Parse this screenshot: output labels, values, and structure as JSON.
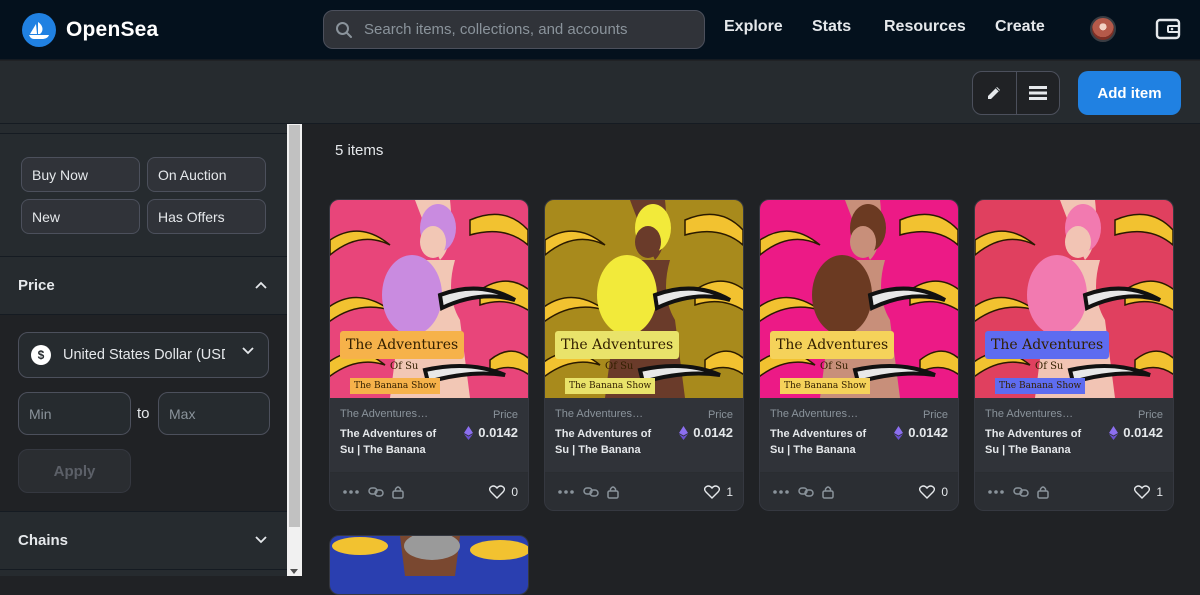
{
  "nav": {
    "brand": "OpenSea",
    "search_placeholder": "Search items, collections, and accounts",
    "links": [
      "Explore",
      "Stats",
      "Resources",
      "Create"
    ]
  },
  "toolbar": {
    "add_item": "Add item"
  },
  "sidebar": {
    "status_filters": [
      "Buy Now",
      "On Auction",
      "New",
      "Has Offers"
    ],
    "price_header": "Price",
    "currency_symbol": "$",
    "currency": "United States Dollar (USD)",
    "min_placeholder": "Min",
    "max_placeholder": "Max",
    "to_label": "to",
    "apply": "Apply",
    "chains_header": "Chains"
  },
  "main": {
    "count": "5 items",
    "cards": [
      {
        "collection": "The Adventures of Su",
        "name": "The Adventures of Su | The Banana Show",
        "price_label": "Price",
        "price": "0.0142",
        "likes": "0",
        "bg": "#e8457a",
        "hair": "#c98be0",
        "skin": "#f2c7b5",
        "title_bg": "#f6b24a"
      },
      {
        "collection": "The Adventures of Su",
        "name": "The Adventures of Su | The Banana Show",
        "price_label": "Price",
        "price": "0.0142",
        "likes": "1",
        "bg": "#a88a1c",
        "hair": "#f2ea3a",
        "skin": "#6a3b2a",
        "title_bg": "#e9e36a"
      },
      {
        "collection": "The Adventures of Su",
        "name": "The Adventures of Su | The Banana Show",
        "price_label": "Price",
        "price": "0.0142",
        "likes": "0",
        "bg": "#ec1a86",
        "hair": "#6b3a22",
        "skin": "#c88f7a",
        "title_bg": "#f5d25a"
      },
      {
        "collection": "The Adventures of Su",
        "name": "The Adventures of Su | The Banana Show",
        "price_label": "Price",
        "price": "0.0142",
        "likes": "1",
        "bg": "#e0405f",
        "hair": "#f27ab0",
        "skin": "#f2c4b4",
        "title_bg": "#5e6cf0"
      }
    ],
    "art_title": "The Adventures",
    "art_of": "Of Su",
    "art_sub": "The Banana Show"
  },
  "colors": {
    "accent": "#2081e2",
    "eth": "#8c6ff0"
  }
}
